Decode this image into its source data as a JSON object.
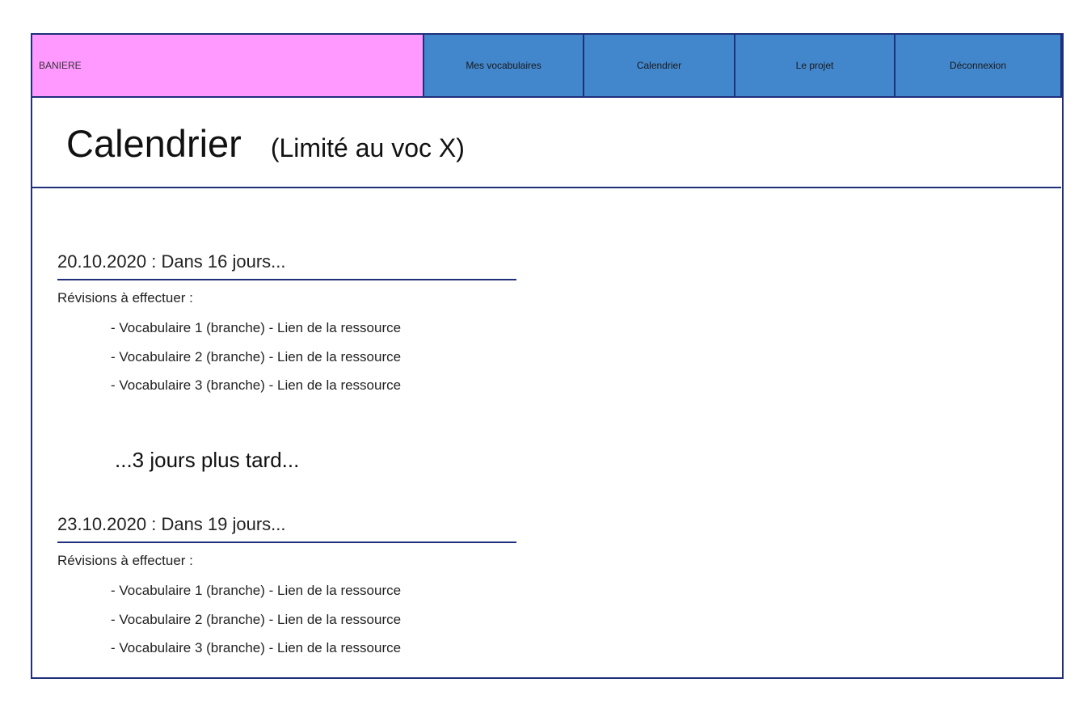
{
  "nav": {
    "banner": "BANIERE",
    "items": [
      {
        "label": "Mes vocabulaires"
      },
      {
        "label": "Calendrier"
      },
      {
        "label": "Le projet"
      },
      {
        "label": "Déconnexion"
      }
    ]
  },
  "page": {
    "title": "Calendrier",
    "subtitle": "(Limité au voc X)"
  },
  "schedule": [
    {
      "heading": "20.10.2020 : Dans 16 jours...",
      "label": "Révisions à effectuer :",
      "items": [
        "- Vocabulaire 1 (branche) - Lien de la ressource",
        "- Vocabulaire 2 (branche) - Lien de la ressource",
        "- Vocabulaire 3 (branche) - Lien de la ressource"
      ]
    },
    {
      "heading": "23.10.2020 : Dans 19 jours...",
      "label": "Révisions à effectuer :",
      "items": [
        "- Vocabulaire 1 (branche) - Lien de la ressource",
        "- Vocabulaire 2 (branche) - Lien de la ressource",
        "- Vocabulaire 3 (branche) - Lien de la ressource"
      ]
    }
  ],
  "gap_text": "...3 jours plus tard...",
  "colors": {
    "banner": "#ff99ff",
    "nav": "#4286cc",
    "border": "#1f2f7a"
  }
}
